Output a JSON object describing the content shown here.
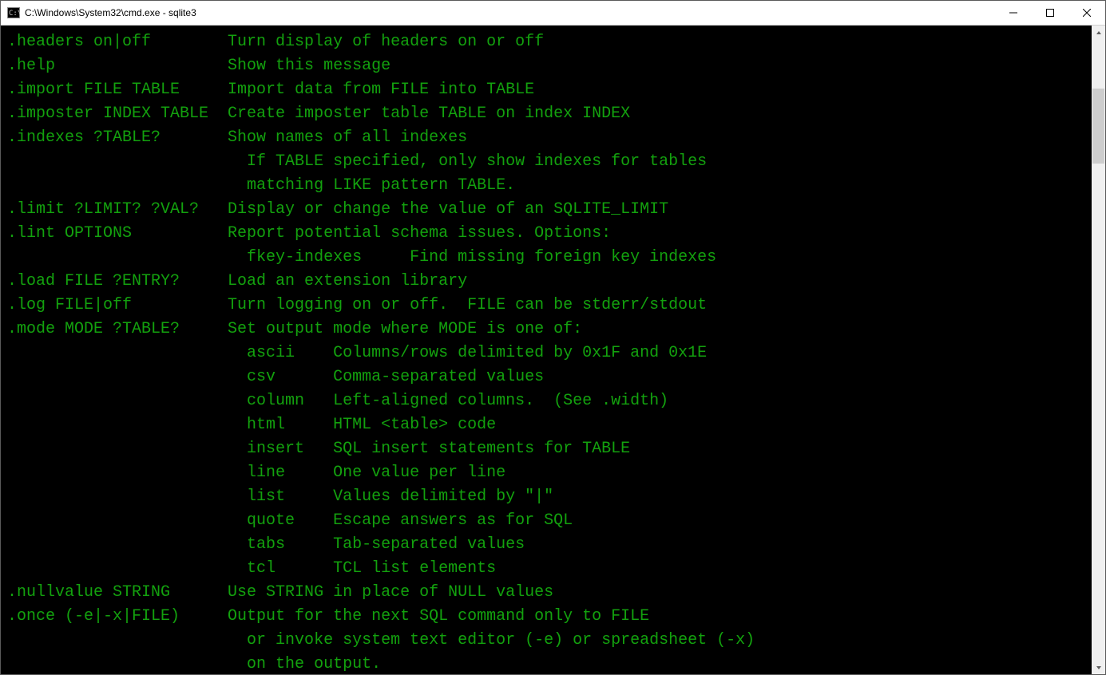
{
  "window": {
    "title": "C:\\Windows\\System32\\cmd.exe - sqlite3"
  },
  "scrollbar": {
    "thumb_top_pct": 8,
    "thumb_height_pct": 12
  },
  "terminal": {
    "lines": [
      ".headers on|off        Turn display of headers on or off",
      ".help                  Show this message",
      ".import FILE TABLE     Import data from FILE into TABLE",
      ".imposter INDEX TABLE  Create imposter table TABLE on index INDEX",
      ".indexes ?TABLE?       Show names of all indexes",
      "                         If TABLE specified, only show indexes for tables",
      "                         matching LIKE pattern TABLE.",
      ".limit ?LIMIT? ?VAL?   Display or change the value of an SQLITE_LIMIT",
      ".lint OPTIONS          Report potential schema issues. Options:",
      "                         fkey-indexes     Find missing foreign key indexes",
      ".load FILE ?ENTRY?     Load an extension library",
      ".log FILE|off          Turn logging on or off.  FILE can be stderr/stdout",
      ".mode MODE ?TABLE?     Set output mode where MODE is one of:",
      "                         ascii    Columns/rows delimited by 0x1F and 0x1E",
      "                         csv      Comma-separated values",
      "                         column   Left-aligned columns.  (See .width)",
      "                         html     HTML <table> code",
      "                         insert   SQL insert statements for TABLE",
      "                         line     One value per line",
      "                         list     Values delimited by \"|\"",
      "                         quote    Escape answers as for SQL",
      "                         tabs     Tab-separated values",
      "                         tcl      TCL list elements",
      ".nullvalue STRING      Use STRING in place of NULL values",
      ".once (-e|-x|FILE)     Output for the next SQL command only to FILE",
      "                         or invoke system text editor (-e) or spreadsheet (-x)",
      "                         on the output."
    ]
  }
}
